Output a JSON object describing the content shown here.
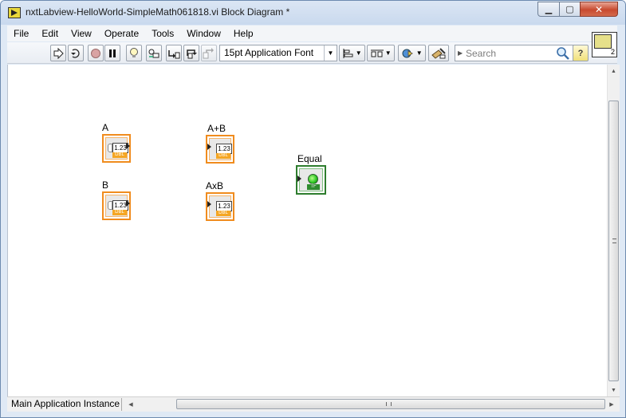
{
  "window": {
    "title": "nxtLabview-HelloWorld-SimpleMath061818.vi Block Diagram *",
    "minimize_glyph": "▁",
    "maximize_glyph": "▢",
    "close_glyph": "✕"
  },
  "menu": {
    "items": [
      "File",
      "Edit",
      "View",
      "Operate",
      "Tools",
      "Window",
      "Help"
    ]
  },
  "toolbar": {
    "font_selector": "15pt Application Font",
    "search_placeholder": "Search",
    "help_label": "?",
    "vi_icon_number": "2",
    "icons": [
      "run-arrow-icon",
      "run-continuously-icon",
      "abort-icon",
      "pause-icon",
      "highlight-execution-icon",
      "retain-wire-values-icon",
      "step-into-icon",
      "step-over-icon",
      "step-out-icon",
      "text-settings-icon",
      "align-objects-icon",
      "distribute-objects-icon",
      "reorder-icon",
      "cleanup-diagram-icon",
      "search-icon",
      "help-icon"
    ]
  },
  "diagram": {
    "terminals": [
      {
        "label": "A",
        "type": "control",
        "value": "1.23",
        "datatype": "DBL"
      },
      {
        "label": "B",
        "type": "control",
        "value": "1.23",
        "datatype": "DBL"
      },
      {
        "label": "A+B",
        "type": "indicator",
        "value": "1.23",
        "datatype": "DBL"
      },
      {
        "label": "AxB",
        "type": "indicator",
        "value": "1.23",
        "datatype": "DBL"
      },
      {
        "label": "Equal",
        "type": "indicator",
        "value": "",
        "datatype": "TF"
      }
    ]
  },
  "statusbar": {
    "context": "Main Application Instance"
  },
  "colors": {
    "numeric_terminal": "#f08c1e",
    "boolean_terminal": "#2e7d2e",
    "led_on": "#28c31f"
  }
}
